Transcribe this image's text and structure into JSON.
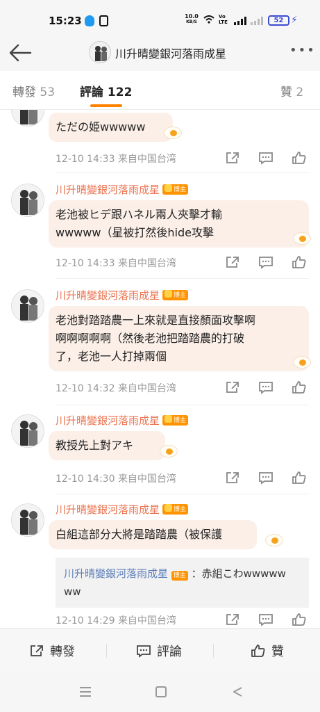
{
  "status_bar": {
    "time": "15:23",
    "net_speed": "10.0",
    "net_unit": "KB/S",
    "volte": "Vo LTE",
    "battery": "52"
  },
  "header": {
    "title": "川升晴變銀河落雨成星"
  },
  "tabs": [
    {
      "label": "轉發",
      "count": "53"
    },
    {
      "label": "評論",
      "count": "122"
    },
    {
      "label": "贊",
      "count": "2"
    }
  ],
  "badge_label": "博主",
  "comments": [
    {
      "text": "ただの姫wwwww",
      "time": "12-10 14:33",
      "source": "来自中国台湾"
    },
    {
      "username": "川升晴變銀河落雨成星",
      "text_line1": "老池被ヒデ跟ハネル兩人夾擊才輸",
      "text_line2": "wwwww（星被打然後hide攻擊",
      "time": "12-10 14:33",
      "source": "来自中国台湾"
    },
    {
      "username": "川升晴變銀河落雨成星",
      "text_line1": "老池對踏踏農一上來就是直接顏面攻擊啊",
      "text_line2": "啊啊啊啊啊（然後老池把踏踏農的打破",
      "text_line3": "了，老池一人打掉兩個",
      "time": "12-10 14:32",
      "source": "来自中国台湾"
    },
    {
      "username": "川升晴變銀河落雨成星",
      "text": "教授先上對アキ",
      "time": "12-10 14:30",
      "source": "来自中国台湾"
    },
    {
      "username": "川升晴變銀河落雨成星",
      "text": "白組這部分大將是踏踏農（被保護",
      "reply_name": "川升晴變銀河落雨成星",
      "reply_text_line1": "：赤組こわwwwww",
      "reply_text_line2": "ww",
      "time": "12-10 14:29",
      "source": "来自中国台湾"
    }
  ],
  "bottom_bar": {
    "repost": "轉發",
    "comment": "評論",
    "like": "贊"
  },
  "colors": {
    "accent": "#ff8200",
    "username": "#eb7350",
    "bubble": "#fbefe8",
    "reply_name": "#5d7fb8"
  }
}
